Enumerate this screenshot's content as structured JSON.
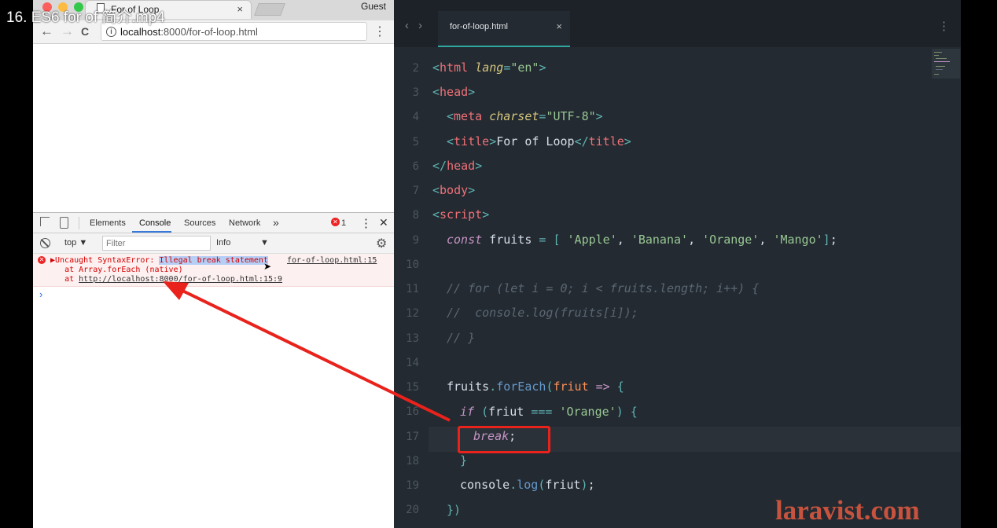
{
  "video": {
    "title": "16. ES6 for of 简介.mp4",
    "watermark": "laravist.com"
  },
  "browser": {
    "tab_title": "For of Loop",
    "tab_close": "×",
    "guest_label": "Guest",
    "back": "←",
    "forward": "→",
    "reload": "C",
    "url_host": "localhost",
    "url_rest": ":8000/for-of-loop.html",
    "menu": "⋮"
  },
  "devtools": {
    "tabs": [
      "Elements",
      "Console",
      "Sources",
      "Network"
    ],
    "more": "»",
    "error_count": "1",
    "kebab": "⋮",
    "close": "✕",
    "context": "top",
    "filter_placeholder": "Filter",
    "level": "Info",
    "error": {
      "prefix": "▶Uncaught SyntaxError: ",
      "highlight": "Illegal break statement",
      "source": "for-of-loop.html:15",
      "line2": "    at Array.forEach (native)",
      "line3_prefix": "    at ",
      "line3_link": "http://localhost:8000/for-of-loop.html:15:9"
    },
    "prompt": "›"
  },
  "editor": {
    "tab_label": "for-of-loop.html",
    "tab_close": "×",
    "nav": "‹›",
    "kebab": "⋮",
    "line_numbers": [
      "2",
      "3",
      "4",
      "5",
      "6",
      "7",
      "8",
      "9",
      "10",
      "11",
      "12",
      "13",
      "14",
      "15",
      "16",
      "17",
      "18",
      "19",
      "20"
    ]
  }
}
